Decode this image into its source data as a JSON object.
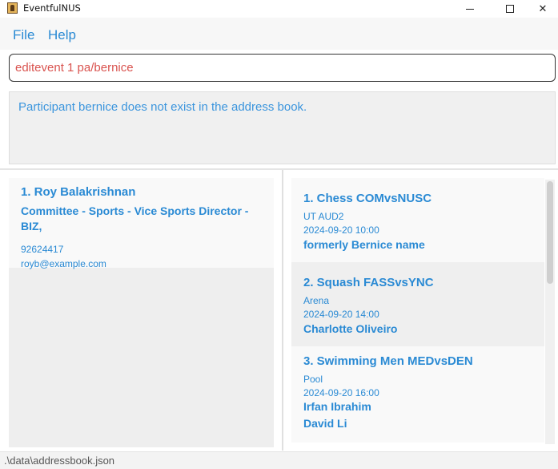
{
  "window": {
    "title": "EventfulNUS",
    "minimize_icon": "minimize-icon",
    "maximize_icon": "maximize-icon",
    "close_glyph": "✕"
  },
  "menu": {
    "items": [
      "File",
      "Help"
    ]
  },
  "command": {
    "value": "editevent 1 pa/bernice",
    "text_color": "#d9534f"
  },
  "result": {
    "message": "Participant bernice does not exist in the address book."
  },
  "persons": [
    {
      "title": "1.  Roy Balakrishnan",
      "role": "Committee - Sports - Vice Sports Director - BIZ,",
      "phone": "92624417",
      "email": "royb@example.com"
    }
  ],
  "events": [
    {
      "title": "1.  Chess COMvsNUSC",
      "venue": "UT AUD2",
      "time": "2024-09-20 10:00",
      "participants": [
        "formerly Bernice name"
      ]
    },
    {
      "title": "2.  Squash FASSvsYNC",
      "venue": "Arena",
      "time": "2024-09-20 14:00",
      "participants": [
        "Charlotte Oliveiro"
      ]
    },
    {
      "title": "3.  Swimming Men MEDvsDEN",
      "venue": "Pool",
      "time": "2024-09-20 16:00",
      "participants": [
        "Irfan Ibrahim",
        "David Li"
      ]
    }
  ],
  "status": {
    "file_path": ".\\data\\addressbook.json"
  },
  "colors": {
    "accent": "#2a8ad4",
    "error": "#d9534f"
  }
}
